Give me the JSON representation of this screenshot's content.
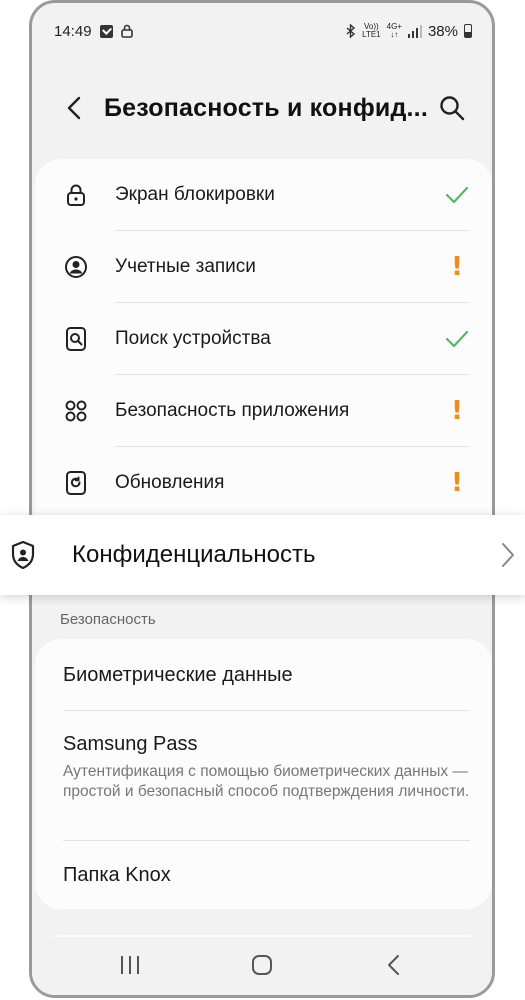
{
  "status_bar": {
    "time": "14:49",
    "volte_top": "Vo))",
    "volte_bottom": "LTE1",
    "network_top": "4G+",
    "network_bottom": "↓↑",
    "battery": "38%"
  },
  "header": {
    "title": "Безопасность и конфид..."
  },
  "security_status": {
    "items": [
      {
        "label": "Экран блокировки",
        "icon": "lock-icon",
        "status": "ok"
      },
      {
        "label": "Учетные записи",
        "icon": "account-icon",
        "status": "warning"
      },
      {
        "label": "Поиск устройства",
        "icon": "find-device-icon",
        "status": "ok"
      },
      {
        "label": "Безопасность приложения",
        "icon": "apps-icon",
        "status": "warning"
      },
      {
        "label": "Обновления",
        "icon": "update-icon",
        "status": "warning"
      }
    ],
    "warning_symbol": "!"
  },
  "highlight": {
    "label": "Конфиденциальность",
    "icon": "privacy-shield-icon"
  },
  "security_section": {
    "header": "Безопасность",
    "items": [
      {
        "label": "Биометрические данные"
      },
      {
        "label": "Samsung Pass",
        "description": "Аутентификация с помощью биометрических данных — простой и безопасный способ подтверждения личности."
      },
      {
        "label": "Папка Knox"
      }
    ]
  },
  "colors": {
    "ok": "#5cb46a",
    "warning": "#f08c1a",
    "background": "#f2f2f2",
    "card": "#fcfcfc"
  }
}
